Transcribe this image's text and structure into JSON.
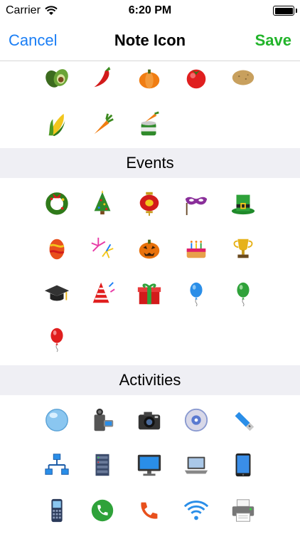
{
  "status_bar": {
    "carrier": "Carrier",
    "time": "6:20 PM",
    "wifi_icon": "wifi-icon",
    "battery_icon": "battery-icon"
  },
  "nav": {
    "cancel_label": "Cancel",
    "title": "Note Icon",
    "save_label": "Save",
    "cancel_color": "#1a7ef5",
    "save_color": "#22b42a"
  },
  "sections": [
    {
      "title": "",
      "icons": [
        "avocado-icon",
        "chili-pepper-icon",
        "pumpkin-icon",
        "tomato-icon",
        "potato-icon",
        "corn-icon",
        "carrot-icon",
        "canned-carrots-icon"
      ]
    },
    {
      "title": "Events",
      "icons": [
        "christmas-wreath-icon",
        "christmas-tree-icon",
        "chinese-lantern-icon",
        "carnival-mask-icon",
        "leprechaun-hat-icon",
        "easter-egg-icon",
        "fireworks-icon",
        "jack-o-lantern-icon",
        "birthday-cake-icon",
        "trophy-icon",
        "graduation-cap-icon",
        "party-hat-icon",
        "gift-box-icon",
        "blue-balloon-icon",
        "green-balloon-icon",
        "red-balloon-icon"
      ]
    },
    {
      "title": "Activities",
      "icons": [
        "bubble-icon",
        "video-camera-icon",
        "photo-camera-icon",
        "cd-icon",
        "usb-drive-icon",
        "network-icon",
        "server-rack-icon",
        "monitor-icon",
        "laptop-icon",
        "tablet-icon",
        "cell-phone-icon",
        "phone-green-icon",
        "phone-handset-icon",
        "wifi-signal-icon",
        "printer-icon"
      ]
    }
  ]
}
